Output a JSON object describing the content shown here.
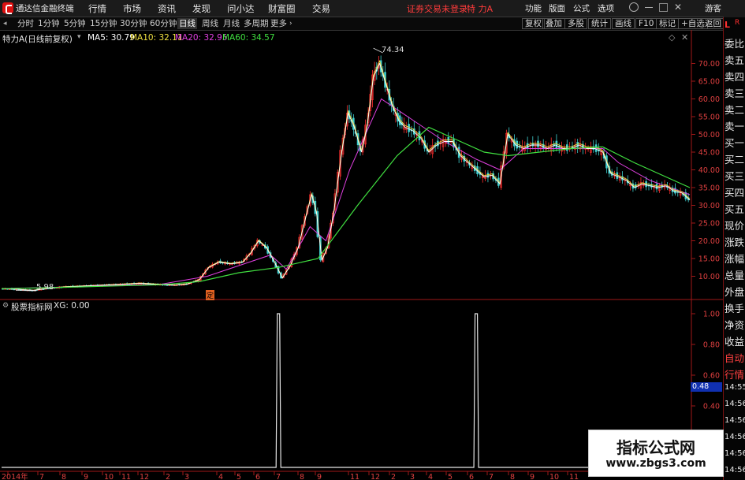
{
  "app": {
    "title": "通达信金融终端",
    "menu": [
      "行情",
      "市场",
      "资讯",
      "发现",
      "问小达",
      "财富圈",
      "交易"
    ],
    "login_status": "证券交易未登录",
    "stock_name": "特 力A",
    "right_menu": [
      "功能",
      "版面",
      "公式",
      "选项"
    ],
    "guest": "游客"
  },
  "periods": {
    "items": [
      "分时",
      "1分钟",
      "5分钟",
      "15分钟",
      "30分钟",
      "60分钟",
      "日线",
      "周线",
      "月线",
      "多周期",
      "更多"
    ],
    "selected": "日线"
  },
  "toolbar_right": [
    "复权",
    "叠加",
    "多股",
    "统计",
    "画线",
    "F10",
    "标记",
    "+自选",
    "返回"
  ],
  "main_chart": {
    "title": "特力A(日线前复权)",
    "ma": [
      {
        "label": "MA5: 30.79",
        "color": "#ffffff"
      },
      {
        "label": "MA10: 32.11",
        "color": "#f0e040"
      },
      {
        "label": "MA20: 32.95",
        "color": "#e040e0"
      },
      {
        "label": "MA60: 34.57",
        "color": "#40e040"
      }
    ],
    "high_label": "74.34",
    "low_label": "5.98",
    "marker": "定"
  },
  "sub_chart": {
    "title": "股票指标网",
    "value_label": "XG: 0.00",
    "cursor_value": "0.48"
  },
  "right_panel": [
    "委比",
    "卖五",
    "卖四",
    "卖三",
    "卖二",
    "卖一",
    "买一",
    "买二",
    "买三",
    "买四",
    "买五",
    "现价",
    "涨跌",
    "涨幅",
    "总量",
    "外盘",
    "换手",
    "净资",
    "收益",
    "自动",
    "行情",
    "14:55",
    "14:56",
    "14:56",
    "14:56",
    "14:56",
    "14:56",
    "14:56",
    "14:56"
  ],
  "watermark": {
    "line1": "指标公式网",
    "line2": "www.zbgs3.com"
  },
  "colors": {
    "up": "#ff3030",
    "down": "#40d0d0",
    "axis": "#e04040",
    "ma5": "#ffffff",
    "ma10": "#f0e040",
    "ma20": "#e040e0",
    "ma60": "#40e040"
  },
  "chart_data": [
    {
      "type": "line",
      "title": "特力A(日线前复权)",
      "y_ticks": [
        "70.00",
        "65.00",
        "60.00",
        "55.00",
        "50.00",
        "45.00",
        "40.00",
        "35.00",
        "30.00",
        "25.00",
        "20.00",
        "15.00",
        "10.00"
      ],
      "x_ticks": [
        "2014年",
        "7",
        "8",
        "9",
        "10",
        "11",
        "12",
        "2",
        "3",
        "4",
        "5",
        "6",
        "7",
        "8",
        "9",
        "11",
        "12",
        "2",
        "3",
        "4",
        "5",
        "6",
        "7",
        "8",
        "9",
        "10",
        "11"
      ],
      "close_points": [
        [
          0,
          6.5
        ],
        [
          20,
          6.3
        ],
        [
          40,
          6.0
        ],
        [
          60,
          6.6
        ],
        [
          80,
          7.0
        ],
        [
          100,
          7.2
        ],
        [
          120,
          7.4
        ],
        [
          140,
          7.6
        ],
        [
          160,
          7.8
        ],
        [
          175,
          8.0
        ],
        [
          190,
          7.8
        ],
        [
          205,
          7.6
        ],
        [
          220,
          7.5
        ],
        [
          235,
          7.8
        ],
        [
          250,
          9.0
        ],
        [
          262,
          12.5
        ],
        [
          275,
          14.0
        ],
        [
          290,
          13.5
        ],
        [
          305,
          14.0
        ],
        [
          315,
          16.5
        ],
        [
          325,
          20.0
        ],
        [
          335,
          18.0
        ],
        [
          345,
          14.0
        ],
        [
          355,
          9.5
        ],
        [
          365,
          13.0
        ],
        [
          375,
          18.0
        ],
        [
          385,
          27.0
        ],
        [
          392,
          33.0
        ],
        [
          398,
          28.0
        ],
        [
          405,
          14.5
        ],
        [
          412,
          18.0
        ],
        [
          420,
          28.0
        ],
        [
          430,
          45.0
        ],
        [
          438,
          56.0
        ],
        [
          446,
          52.0
        ],
        [
          455,
          45.0
        ],
        [
          462,
          52.0
        ],
        [
          470,
          66.0
        ],
        [
          478,
          70.0
        ],
        [
          486,
          64.0
        ],
        [
          494,
          58.0
        ],
        [
          502,
          54.0
        ],
        [
          510,
          52.0
        ],
        [
          520,
          51.0
        ],
        [
          530,
          49.0
        ],
        [
          540,
          45.0
        ],
        [
          550,
          47.0
        ],
        [
          560,
          48.0
        ],
        [
          570,
          48.0
        ],
        [
          580,
          44.0
        ],
        [
          590,
          42.0
        ],
        [
          600,
          40.0
        ],
        [
          610,
          38.0
        ],
        [
          620,
          38.5
        ],
        [
          630,
          36.0
        ],
        [
          640,
          50.0
        ],
        [
          650,
          47.0
        ],
        [
          660,
          46.0
        ],
        [
          670,
          47.0
        ],
        [
          680,
          47.0
        ],
        [
          690,
          46.0
        ],
        [
          700,
          47.0
        ],
        [
          710,
          46.0
        ],
        [
          720,
          46.0
        ],
        [
          730,
          47.0
        ],
        [
          740,
          46.0
        ],
        [
          750,
          46.0
        ],
        [
          760,
          45.0
        ],
        [
          770,
          39.0
        ],
        [
          780,
          38.0
        ],
        [
          790,
          37.0
        ],
        [
          800,
          35.0
        ],
        [
          810,
          36.0
        ],
        [
          820,
          35.5
        ],
        [
          830,
          35.0
        ],
        [
          840,
          35.5
        ],
        [
          850,
          34.0
        ],
        [
          860,
          33.5
        ],
        [
          870,
          31.5
        ]
      ],
      "ma60_points": [
        [
          0,
          6.5
        ],
        [
          100,
          7.0
        ],
        [
          200,
          7.6
        ],
        [
          250,
          8.5
        ],
        [
          300,
          11.0
        ],
        [
          350,
          12.5
        ],
        [
          400,
          15.0
        ],
        [
          450,
          30.0
        ],
        [
          500,
          44.0
        ],
        [
          540,
          52.0
        ],
        [
          570,
          49.0
        ],
        [
          610,
          45.0
        ],
        [
          640,
          44.0
        ],
        [
          680,
          45.0
        ],
        [
          720,
          46.0
        ],
        [
          760,
          46.5
        ],
        [
          800,
          42.0
        ],
        [
          840,
          38.0
        ],
        [
          870,
          35.0
        ]
      ],
      "ma20_points": [
        [
          0,
          6.5
        ],
        [
          100,
          7.1
        ],
        [
          200,
          7.7
        ],
        [
          260,
          10.0
        ],
        [
          300,
          13.0
        ],
        [
          340,
          16.0
        ],
        [
          360,
          12.0
        ],
        [
          390,
          24.0
        ],
        [
          410,
          20.0
        ],
        [
          440,
          40.0
        ],
        [
          480,
          60.0
        ],
        [
          520,
          54.0
        ],
        [
          560,
          48.0
        ],
        [
          600,
          43.0
        ],
        [
          630,
          40.0
        ],
        [
          660,
          46.0
        ],
        [
          700,
          46.0
        ],
        [
          760,
          46.0
        ],
        [
          780,
          42.0
        ],
        [
          820,
          37.0
        ],
        [
          870,
          33.0
        ]
      ],
      "ylim": [
        5.0,
        75.0
      ]
    },
    {
      "type": "line",
      "title": "股票指标网",
      "y_ticks": [
        "1.00",
        "0.80",
        "0.60",
        "0.48",
        "0.40"
      ],
      "series": [
        {
          "name": "XG",
          "signal_x": [
            350,
            600
          ],
          "peak": 1.0
        }
      ],
      "ylim": [
        0.0,
        1.0
      ]
    }
  ]
}
